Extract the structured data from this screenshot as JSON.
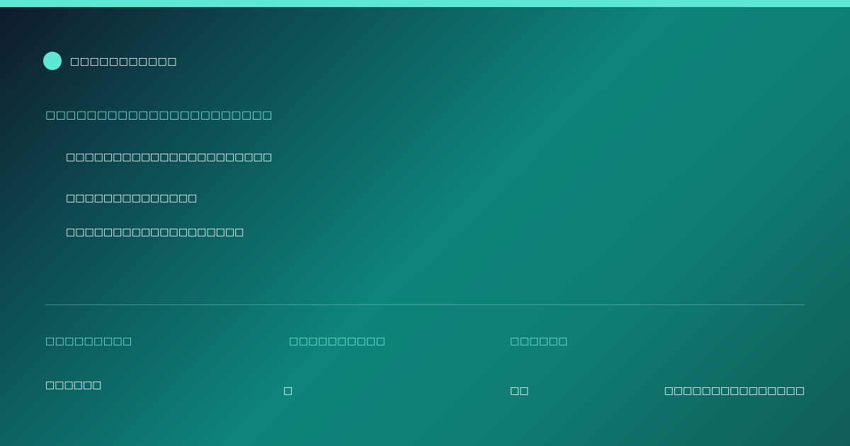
{
  "colors": {
    "accent": "#5ee8d4",
    "label": "#7fe8d6",
    "text": "#ffffff"
  },
  "header": {
    "brand": "□□□□□□□□□□□"
  },
  "main": {
    "eyebrow": "□□□□□□□□□□□□□□□□□□□□□□",
    "lines": [
      "□□□□□□□□□□□□□□□□□□□□□□",
      "□□□□□□□□□□□□□□",
      "□□□□□□□□□□□□□□□□□□□"
    ]
  },
  "footer": {
    "labels": [
      "□□□□□□□□□",
      "□□□□□□□□□□",
      "□□□□□□"
    ],
    "values": [
      "□□□□□□",
      "□",
      "□□",
      "□□□□□□□□□□□□□□□"
    ]
  }
}
